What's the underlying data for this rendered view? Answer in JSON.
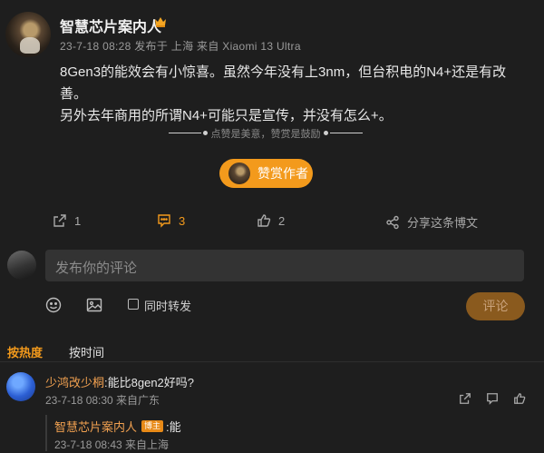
{
  "author": {
    "name": "智慧芯片案内人",
    "meta": "23-7-18 08:28  发布于 上海  来自 Xiaomi 13 Ultra"
  },
  "post": {
    "line1": "8Gen3的能效会有小惊喜。虽然今年没有上3nm，但台积电的N4+还是有改善。",
    "line2": "另外去年商用的所谓N4+可能只是宣传，并没有怎么+。"
  },
  "reward": {
    "tip": "点赞是美意，赞赏是鼓励",
    "button": "赞赏作者"
  },
  "actions": {
    "repost_count": "1",
    "comment_count": "3",
    "like_count": "2",
    "share_label": "分享这条博文"
  },
  "composer": {
    "placeholder": "发布你的评论",
    "repost_label": "同时转发",
    "submit_label": "评论"
  },
  "sort": {
    "hot": "按热度",
    "time": "按时间"
  },
  "comments": [
    {
      "user": "少鸿改少桐",
      "text": ":能比8gen2好吗?",
      "meta": "23-7-18 08:30 来自广东"
    }
  ],
  "reply": {
    "user": "智慧芯片案内人",
    "badge": "博主",
    "text": ":能",
    "meta": "23-7-18 08:43 来自上海"
  },
  "colors": {
    "accent": "#f39a1c",
    "background": "#1e1e1e",
    "username": "#f0a050"
  }
}
